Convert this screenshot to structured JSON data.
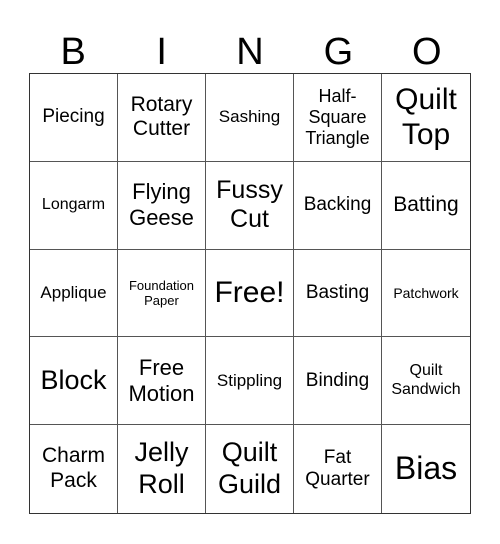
{
  "header": {
    "letters": [
      "B",
      "I",
      "N",
      "G",
      "O"
    ]
  },
  "cells": [
    "Piecing",
    "Rotary Cutter",
    "Sashing",
    "Half-Square Triangle",
    "Quilt Top",
    "Longarm",
    "Flying Geese",
    "Fussy Cut",
    "Backing",
    "Batting",
    "Applique",
    "Foundation Paper",
    "Free!",
    "Basting",
    "Patchwork",
    "Block",
    "Free Motion",
    "Stippling",
    "Binding",
    "Quilt Sandwich",
    "Charm Pack",
    "Jelly Roll",
    "Quilt Guild",
    "Fat Quarter",
    "Bias"
  ]
}
